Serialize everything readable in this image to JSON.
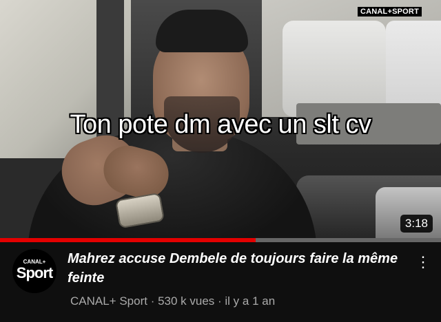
{
  "thumbnail": {
    "overlay_caption": "Ton pote dm avec un slt cv",
    "broadcaster_logo": "CANAL+SPORT",
    "duration": "3:18",
    "watch_progress": 0.58
  },
  "channel": {
    "avatar_small": "CANAL+",
    "avatar_big": "Sport"
  },
  "video": {
    "title": "Mahrez accuse Dembele de toujours faire la même feinte",
    "meta": "CANAL+ Sport · 530 k vues · il y a 1 an"
  },
  "menu_icon": "vertical-ellipsis",
  "colors": {
    "background": "#0f0f0f",
    "progress_red": "#e40000",
    "meta_gray": "#aaaaaa"
  }
}
